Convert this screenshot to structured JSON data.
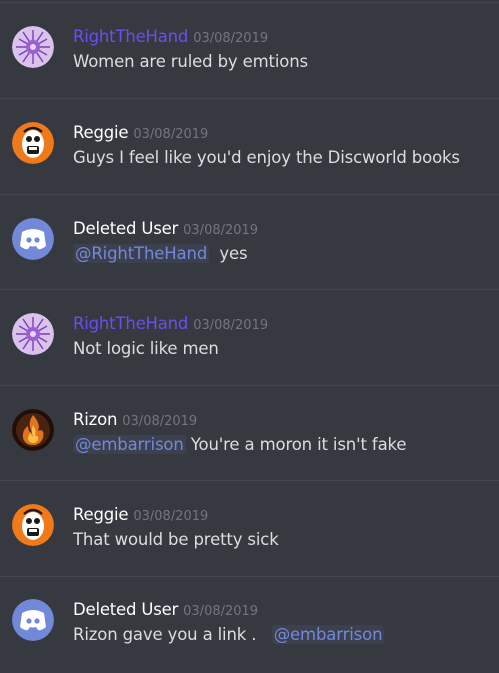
{
  "messages": [
    {
      "username": "RightTheHand",
      "timestamp": "03/08/2019",
      "avatar": "purple-crystal-avatar",
      "username_color": "#6b4ef0",
      "mention": "",
      "text": "Women are ruled by emtions",
      "trailing_mention": ""
    },
    {
      "username": "Reggie",
      "timestamp": "03/08/2019",
      "avatar": "orange-cartoon-avatar",
      "username_color": "#ffffff",
      "mention": "",
      "text": "Guys I feel like you'd enjoy the Discworld books",
      "trailing_mention": ""
    },
    {
      "username": "Deleted User",
      "timestamp": "03/08/2019",
      "avatar": "discord-logo-avatar",
      "username_color": "#ffffff",
      "mention": "@RightTheHand",
      "text": "yes",
      "trailing_mention": ""
    },
    {
      "username": "RightTheHand",
      "timestamp": "03/08/2019",
      "avatar": "purple-crystal-avatar",
      "username_color": "#6b4ef0",
      "mention": "",
      "text": "Not logic like men",
      "trailing_mention": ""
    },
    {
      "username": "Rizon",
      "timestamp": "03/08/2019",
      "avatar": "fire-avatar",
      "username_color": "#ffffff",
      "mention": "@embarrison",
      "text": "You're a moron it isn't fake",
      "trailing_mention": ""
    },
    {
      "username": "Reggie",
      "timestamp": "03/08/2019",
      "avatar": "orange-cartoon-avatar",
      "username_color": "#ffffff",
      "mention": "",
      "text": "That would be pretty sick",
      "trailing_mention": ""
    },
    {
      "username": "Deleted User",
      "timestamp": "03/08/2019",
      "avatar": "discord-logo-avatar",
      "username_color": "#ffffff",
      "mention": "",
      "text": "Rizon gave you a link .",
      "trailing_mention": "@embarrison"
    }
  ],
  "colors": {
    "background": "#36393f",
    "divider": "#42454a",
    "text": "#dcddde",
    "timestamp": "#72767d",
    "mention_text": "#7289da",
    "mention_bg": "#3d414f",
    "discord_blurple": "#7289da"
  }
}
